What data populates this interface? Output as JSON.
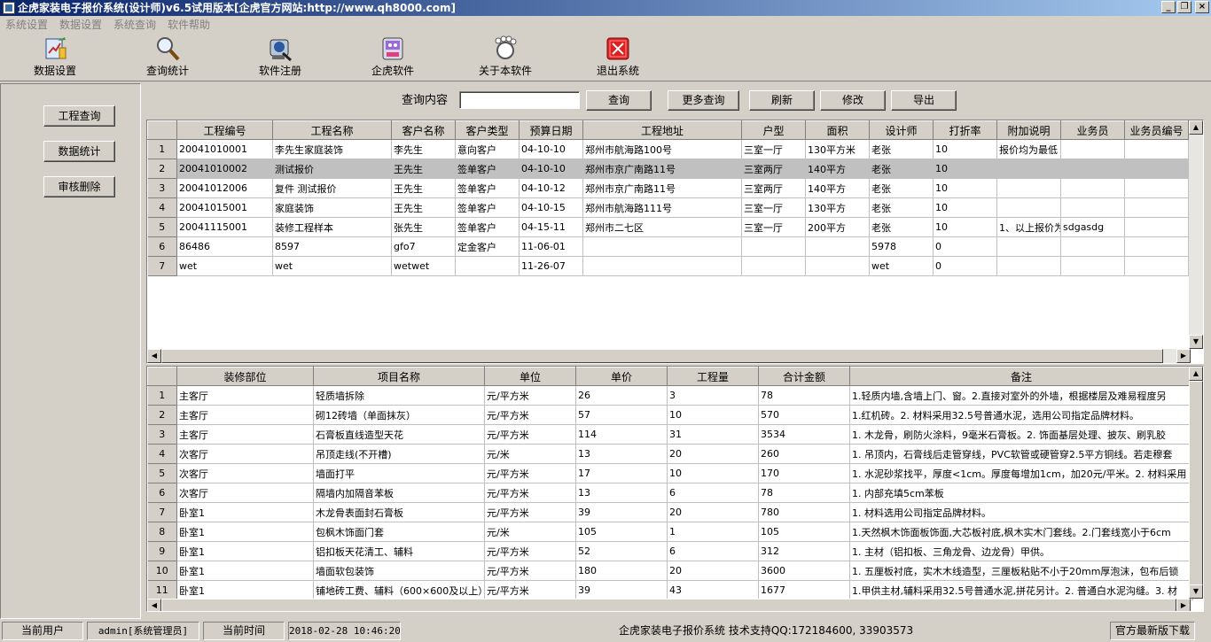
{
  "window": {
    "title": "企虎家装电子报价系统(设计师)v6.5试用版本[企虎官方网站:http://www.qh8000.com]",
    "min_glyph": "_",
    "max_glyph": "❐",
    "close_glyph": "×"
  },
  "menu": [
    "系统设置",
    "数据设置",
    "系统查询",
    "软件帮助"
  ],
  "toolbar": {
    "items": [
      {
        "label": "数据设置",
        "icon": "data-settings-icon"
      },
      {
        "label": "查询统计",
        "icon": "magnifier-icon"
      },
      {
        "label": "软件注册",
        "icon": "register-icon"
      },
      {
        "label": "企虎软件",
        "icon": "software-icon"
      },
      {
        "label": "关于本软件",
        "icon": "about-icon"
      },
      {
        "label": "退出系统",
        "icon": "exit-icon"
      }
    ]
  },
  "left": {
    "buttons": [
      "工程查询",
      "数据统计",
      "审核删除"
    ]
  },
  "search": {
    "label": "查询内容",
    "value": "",
    "buttons": [
      "查询",
      "更多查询",
      "刷新",
      "修改",
      "导出"
    ]
  },
  "projects": {
    "headers": [
      "工程编号",
      "工程名称",
      "客户名称",
      "客户类型",
      "预算日期",
      "工程地址",
      "户型",
      "面积",
      "设计师",
      "打折率",
      "附加说明",
      "业务员",
      "业务员编号"
    ],
    "rows": [
      [
        "1",
        "20041010001",
        "李先生家庭装饰",
        "李先生",
        "意向客户",
        "04-10-10",
        "郑州市航海路100号",
        "三室一厅",
        "130平方米",
        "老张",
        "10",
        "报价均为最低",
        "",
        ""
      ],
      [
        "2",
        "20041010002",
        "测试报价",
        "王先生",
        "签单客户",
        "04-10-10",
        "郑州市京广南路11号",
        "三室两厅",
        "140平方",
        "老张",
        "10",
        "",
        "",
        ""
      ],
      [
        "3",
        "20041012006",
        "复件 测试报价",
        "王先生",
        "签单客户",
        "04-10-12",
        "郑州市京广南路11号",
        "三室两厅",
        "140平方",
        "老张",
        "10",
        "",
        "",
        ""
      ],
      [
        "4",
        "20041015001",
        "家庭装饰",
        "王先生",
        "签单客户",
        "04-10-15",
        "郑州市航海路111号",
        "三室一厅",
        "130平方",
        "老张",
        "10",
        "",
        "",
        ""
      ],
      [
        "5",
        "20041115001",
        "装修工程样本",
        "张先生",
        "签单客户",
        "04-15-11",
        "郑州市二七区",
        "三室一厅",
        "200平方",
        "老张",
        "10",
        "1、以上报价为",
        "sdgasdg",
        ""
      ],
      [
        "6",
        "86486",
        "8597",
        "gfo7",
        "定金客户",
        "11-06-01",
        "",
        "",
        "",
        "5978",
        "0",
        "",
        "",
        ""
      ],
      [
        "7",
        "wet",
        "wet",
        "wetwet",
        "",
        "11-26-07",
        "",
        "",
        "",
        "wet",
        "0",
        "",
        "",
        ""
      ]
    ],
    "selected_row": 1
  },
  "details": {
    "headers": [
      "装修部位",
      "项目名称",
      "单位",
      "单价",
      "工程量",
      "合计金额",
      "备注"
    ],
    "rows": [
      [
        "1",
        "主客厅",
        "轻质墙拆除",
        "元/平方米",
        "26",
        "3",
        "78",
        "1.轻质内墙,含墙上门、窗。2.直接对室外的外墙，根据楼层及难易程度另"
      ],
      [
        "2",
        "主客厅",
        "砌12砖墙（单面抹灰）",
        "元/平方米",
        "57",
        "10",
        "570",
        "1.红机砖。2. 材料采用32.5号普通水泥，选用公司指定品牌材料。"
      ],
      [
        "3",
        "主客厅",
        "石膏板直线造型天花",
        "元/平方米",
        "114",
        "31",
        "3534",
        "1. 木龙骨，刷防火涂料，9毫米石膏板。2. 饰面基层处理、披灰、刷乳胶"
      ],
      [
        "4",
        "次客厅",
        "吊顶走线(不开槽)",
        "元/米",
        "13",
        "20",
        "260",
        "1. 吊顶内，石膏线后走管穿线，PVC软管或硬管穿2.5平方铜线。若走穆套"
      ],
      [
        "5",
        "次客厅",
        "墙面打平",
        "元/平方米",
        "17",
        "10",
        "170",
        "1. 水泥砂浆找平，厚度<1cm。厚度每增加1cm，加20元/平米。2. 材料采用"
      ],
      [
        "6",
        "次客厅",
        "隔墙内加隔音苯板",
        "元/平方米",
        "13",
        "6",
        "78",
        "1. 内部充填5cm苯板"
      ],
      [
        "7",
        "卧室1",
        "木龙骨表面封石膏板",
        "元/平方米",
        "39",
        "20",
        "780",
        "1. 材料选用公司指定品牌材料。"
      ],
      [
        "8",
        "卧室1",
        "包枫木饰面门套",
        "元/米",
        "105",
        "1",
        "105",
        "1.天然枫木饰面板饰面,大芯板衬底,枫木实木门套线。2.门套线宽小于6cm"
      ],
      [
        "9",
        "卧室1",
        "铝扣板天花清工、辅料",
        "元/平方米",
        "52",
        "6",
        "312",
        "1. 主材（铝扣板、三角龙骨、边龙骨）甲供。"
      ],
      [
        "10",
        "卧室1",
        "墙面软包装饰",
        "元/平方米",
        "180",
        "20",
        "3600",
        "1. 五厘板衬底，实木木线造型，三厘板粘贴不小于20mm厚泡沫，包布后锁"
      ],
      [
        "11",
        "卧室1",
        "铺地砖工费、辅料（600×600及以上）",
        "元/平方米",
        "39",
        "43",
        "1677",
        "1.甲供主材,辅料采用32.5号普通水泥,拼花另计。2. 普通白水泥沟缝。3. 材"
      ]
    ]
  },
  "scroll": {
    "up": "▲",
    "down": "▼",
    "left": "◀",
    "right": "▶"
  },
  "status": {
    "user_label": "当前用户",
    "user_value": "admin[系统管理员]",
    "time_label": "当前时间",
    "time_value": "2018-02-28 10:46:20",
    "center_text": "企虎家装电子报价系统  技术支持QQ:172184600, 33903573",
    "right_button": "官方最新版下载"
  }
}
